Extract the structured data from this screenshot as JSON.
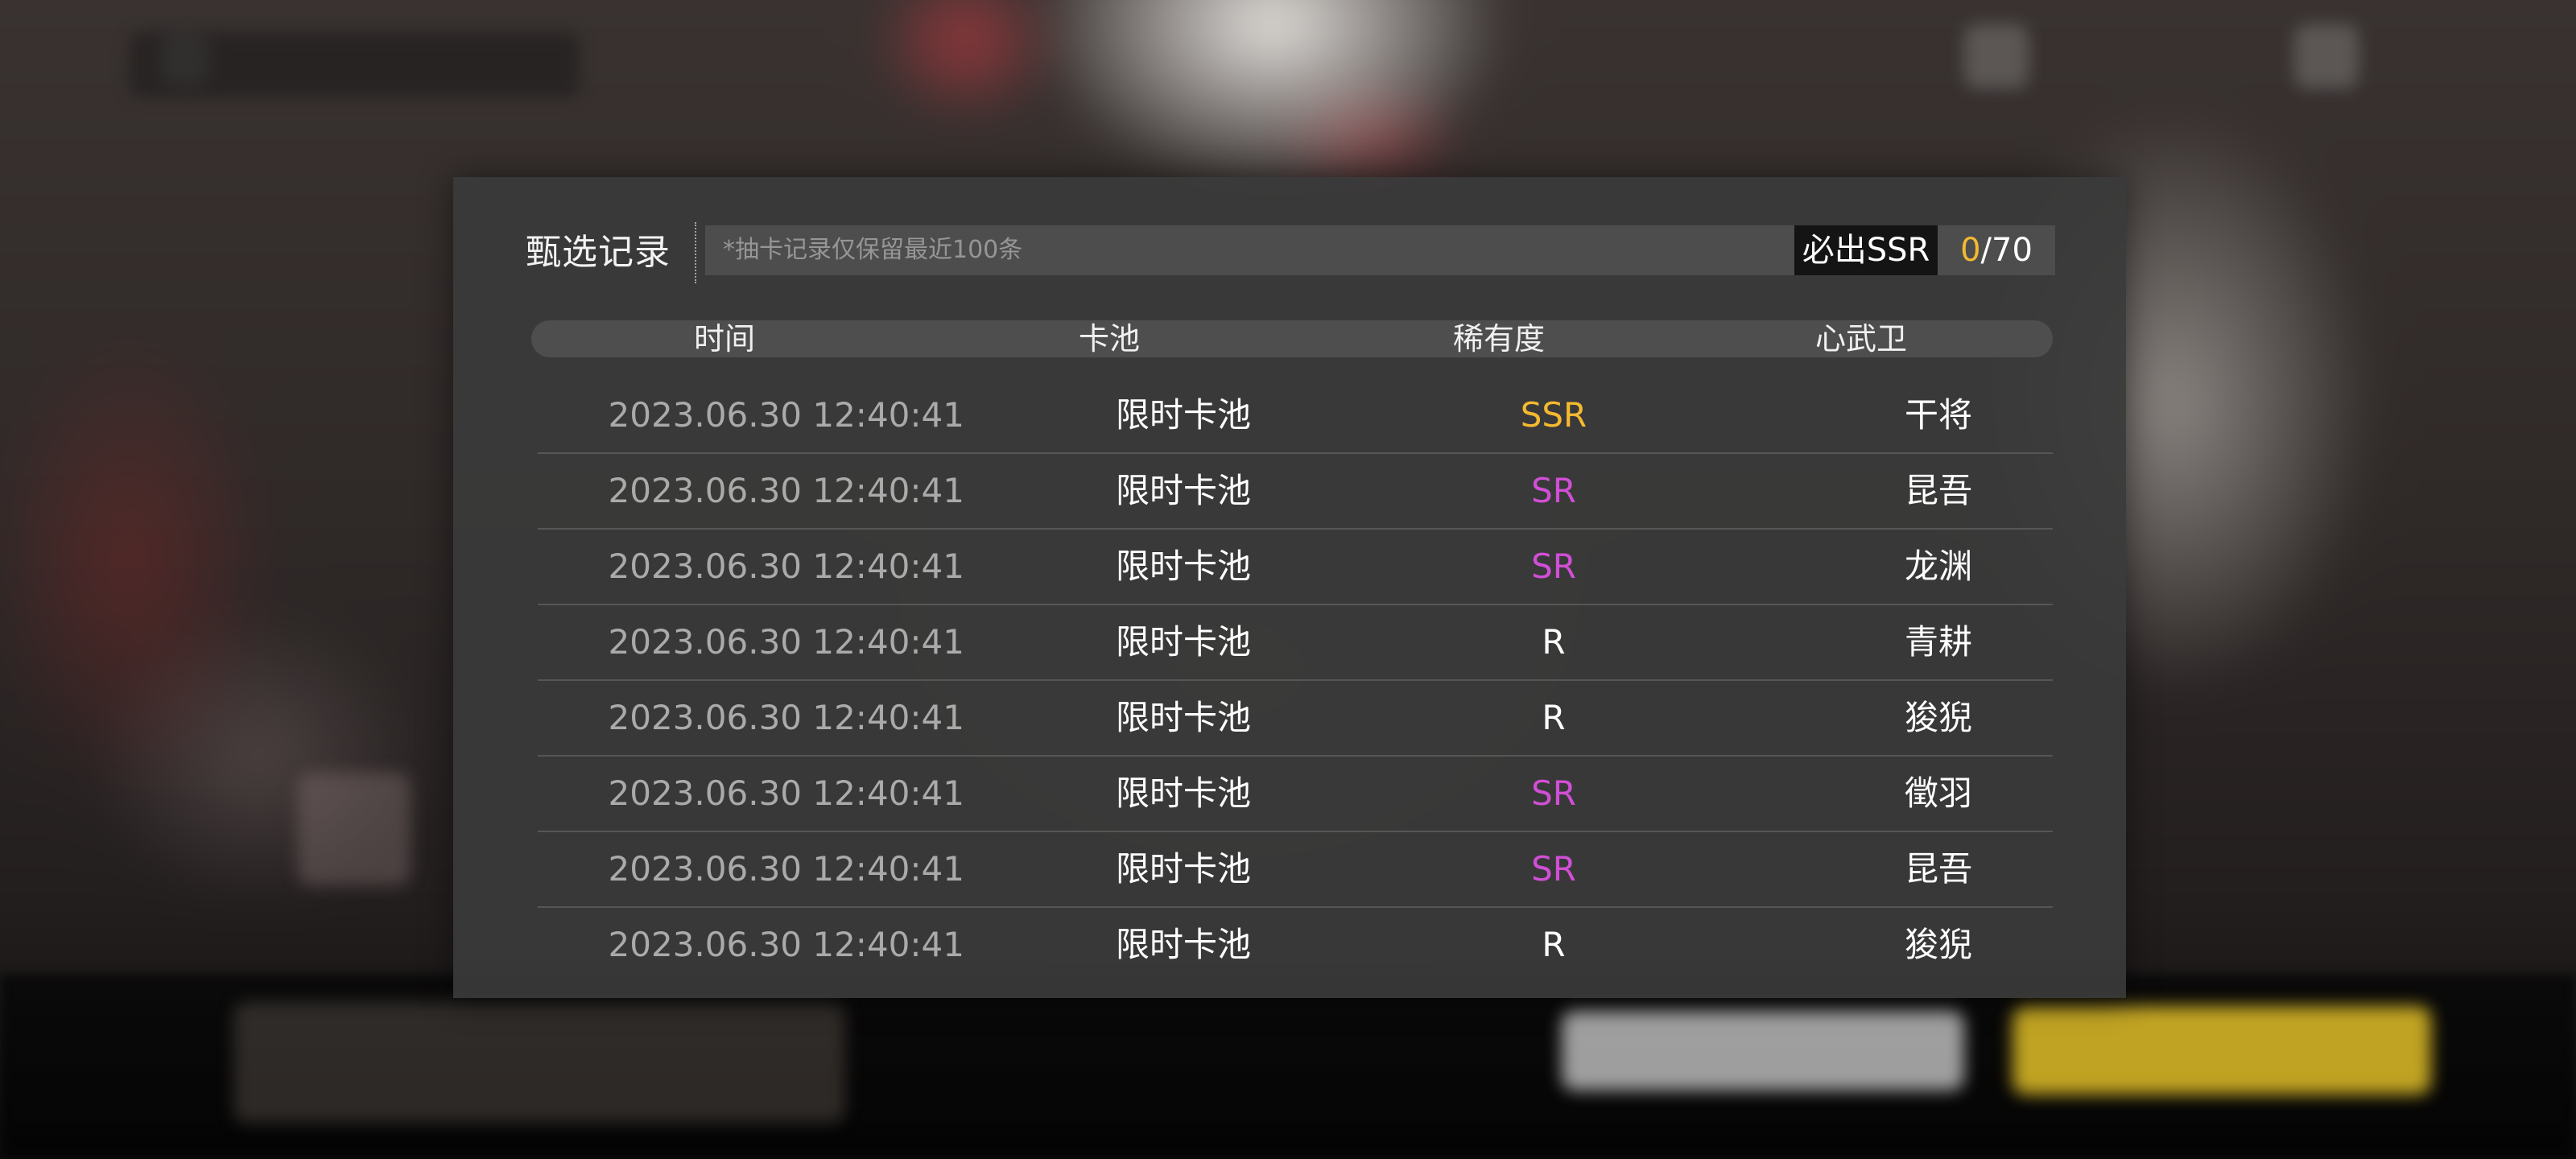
{
  "dialog": {
    "title": "甄选记录",
    "notice": "*抽卡记录仅保留最近100条",
    "guarantee": {
      "label": "必出SSR",
      "current": "0",
      "total": "/70"
    }
  },
  "table": {
    "headers": {
      "time": "时间",
      "pool": "卡池",
      "rarity": "稀有度",
      "guard": "心武卫"
    },
    "rows": [
      {
        "time": "2023.06.30  12:40:41",
        "pool": "限时卡池",
        "rarity": "SSR",
        "guard": "干将"
      },
      {
        "time": "2023.06.30  12:40:41",
        "pool": "限时卡池",
        "rarity": "SR",
        "guard": "昆吾"
      },
      {
        "time": "2023.06.30  12:40:41",
        "pool": "限时卡池",
        "rarity": "SR",
        "guard": "龙渊"
      },
      {
        "time": "2023.06.30  12:40:41",
        "pool": "限时卡池",
        "rarity": "R",
        "guard": "青耕"
      },
      {
        "time": "2023.06.30  12:40:41",
        "pool": "限时卡池",
        "rarity": "R",
        "guard": "狻猊"
      },
      {
        "time": "2023.06.30  12:40:41",
        "pool": "限时卡池",
        "rarity": "SR",
        "guard": "徵羽"
      },
      {
        "time": "2023.06.30  12:40:41",
        "pool": "限时卡池",
        "rarity": "SR",
        "guard": "昆吾"
      },
      {
        "time": "2023.06.30  12:40:41",
        "pool": "限时卡池",
        "rarity": "R",
        "guard": "狻猊"
      }
    ]
  },
  "colors": {
    "SSR": "#f4b930",
    "SR": "#d14fd6",
    "R": "#ffffff",
    "accent": "#f4b930"
  }
}
